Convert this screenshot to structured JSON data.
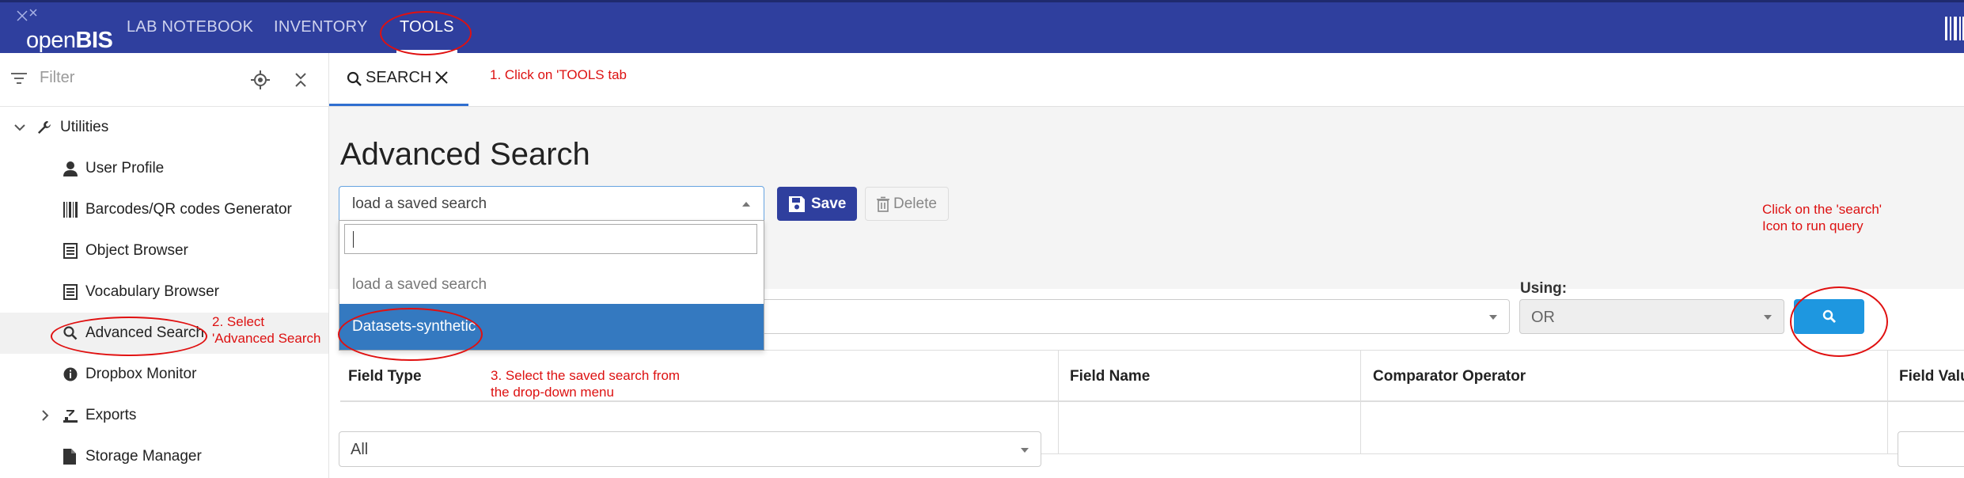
{
  "app": {
    "logo_text": "openBIS",
    "nav_tabs": [
      {
        "label": "LAB NOTEBOOK"
      },
      {
        "label": "INVENTORY"
      },
      {
        "label": "TOOLS"
      }
    ],
    "brand_color": "#2f3f9e"
  },
  "sidebar": {
    "filter_placeholder": "Filter",
    "items": [
      {
        "label": "Utilities"
      },
      {
        "label": "User Profile"
      },
      {
        "label": "Barcodes/QR codes Generator"
      },
      {
        "label": "Object Browser"
      },
      {
        "label": "Vocabulary Browser"
      },
      {
        "label": "Advanced Search"
      },
      {
        "label": "Dropbox Monitor"
      },
      {
        "label": "Exports"
      },
      {
        "label": "Storage Manager"
      }
    ]
  },
  "main": {
    "tab_label": "SEARCH",
    "title": "Advanced Search",
    "saved_search": {
      "value": "load a saved search",
      "options": [
        "load a saved search",
        "Datasets-synthetic"
      ]
    },
    "save_label": "Save",
    "delete_label": "Delete",
    "using_label": "Using:",
    "using_value": "OR",
    "table_headers": [
      "Field Type",
      "Field Name",
      "Comparator Operator",
      "Field Valu"
    ],
    "field_type_value": "All"
  },
  "annotations": {
    "step1": "1. Click on 'TOOLS tab",
    "step2_line1": "2. Select",
    "step2_line2": "'Advanced Search",
    "step3_line1": "3. Select the saved search from",
    "step3_line2": "the drop-down menu",
    "step4_line1": "Click on the 'search'",
    "step4_line2": "Icon to run query"
  }
}
